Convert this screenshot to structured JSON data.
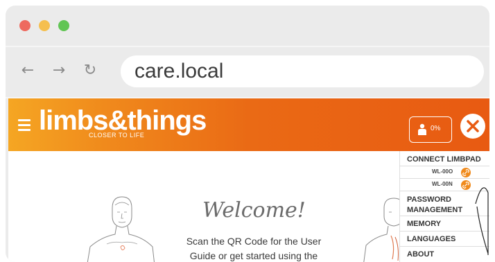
{
  "browser": {
    "url": "care.local",
    "back_symbol": "←",
    "forward_symbol": "→",
    "reload_symbol": "↻"
  },
  "app": {
    "logo": "limbs&things",
    "tagline": "CLOSER TO LIFE",
    "progress_percent": "0%",
    "accent_color": "#e85a12"
  },
  "main": {
    "welcome": "Welcome!",
    "intro_line1": "Scan the QR Code for the User",
    "intro_line2": "Guide or get started using the"
  },
  "menu": {
    "connect_label": "CONNECT LIMBPAD",
    "devices": [
      {
        "name": "WL-00O"
      },
      {
        "name": "WL-00N"
      }
    ],
    "password_line1": "PASSWORD",
    "password_line2": "MANAGEMENT",
    "memory_label": "MEMORY",
    "languages_label": "LANGUAGES",
    "about_label": "ABOUT"
  }
}
